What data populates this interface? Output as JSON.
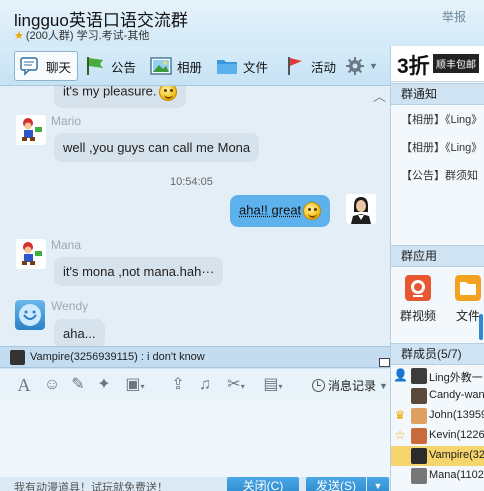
{
  "header": {
    "title": "lingguo英语口语交流群",
    "subtitle": "(200人群) 学习.考试-其他",
    "report": "举报"
  },
  "tabs": [
    {
      "label": "聊天",
      "icon": "chat-icon"
    },
    {
      "label": "公告",
      "icon": "announcement-flag-icon"
    },
    {
      "label": "相册",
      "icon": "album-icon"
    },
    {
      "label": "文件",
      "icon": "folder-icon"
    },
    {
      "label": "活动",
      "icon": "activity-flag-icon"
    }
  ],
  "chat": {
    "messages": [
      {
        "sender": "",
        "text": "it's my pleasure."
      },
      {
        "sender": "Mario",
        "text": "well ,you guys can call me Mona"
      },
      {
        "time": "10:54:05"
      },
      {
        "sender": "me",
        "text": "aha!! great"
      },
      {
        "sender": "Mana",
        "text": "it's mona ,not mana.hah···"
      },
      {
        "sender": "Wendy",
        "text": "aha..."
      }
    ]
  },
  "notification": {
    "text": "Vampire(3256939115) : i don't know"
  },
  "input": {
    "history_label": "消息记录",
    "promo_text": "我有动漫道具！试玩就免费送！",
    "close_label": "关闭(C)",
    "send_label": "发送(S)"
  },
  "sidebar": {
    "ad": {
      "discount": "3折",
      "tag": "顺丰包邮"
    },
    "notices_header": "群通知",
    "notices": [
      "【相册】《Ling》",
      "【相册】《Ling》",
      "【公告】群须知"
    ],
    "apps_header": "群应用",
    "apps": [
      {
        "label": "群视频",
        "icon": "group-video-icon"
      },
      {
        "label": "文件",
        "icon": "group-file-icon"
      }
    ],
    "members_header": "群成员(5/7)",
    "members": [
      {
        "name": "Ling外教一",
        "badge": "owner-icon"
      },
      {
        "name": "Candy-wan",
        "badge": ""
      },
      {
        "name": "John(13959",
        "badge": "crown-icon"
      },
      {
        "name": "Kevin(12260",
        "badge": "star-icon"
      },
      {
        "name": "Vampire(32",
        "badge": ""
      },
      {
        "name": "Mana(11028",
        "badge": ""
      }
    ]
  },
  "colors": {
    "accent": "#2c89cc",
    "my_bubble": "#5db1ec",
    "other_bubble": "#d7e3ec",
    "selected_member": "#f6d56c"
  }
}
